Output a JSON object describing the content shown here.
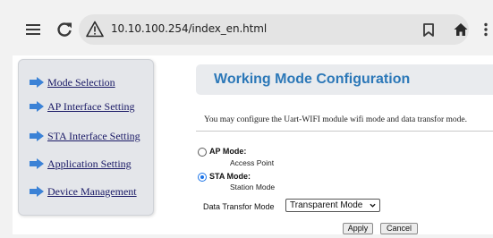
{
  "browser": {
    "url": "10.10.100.254/index_en.html",
    "icons": [
      "menu-icon",
      "reload-icon",
      "warning-icon",
      "bookmark-icon",
      "home-icon",
      "more-icon"
    ]
  },
  "sidebar": {
    "items": [
      {
        "label": "Mode Selection"
      },
      {
        "label": "AP Interface Setting"
      },
      {
        "label": "STA Interface Setting"
      },
      {
        "label": "Application Setting"
      },
      {
        "label": "Device Management"
      }
    ]
  },
  "main": {
    "title": "Working Mode Configuration",
    "description": "You may configure the Uart-WIFI module wifi mode and data transfor mode.",
    "modes": [
      {
        "label": "AP Mode:",
        "sub": "Access Point",
        "checked": false
      },
      {
        "label": "STA Mode:",
        "sub": "Station Mode",
        "checked": true
      }
    ],
    "transfer_label": "Data Transfor Mode",
    "transfer_value": "Transparent Mode",
    "apply_label": "Apply",
    "cancel_label": "Cancel"
  },
  "colors": {
    "title": "#2c78b8",
    "nav_link": "#1a1a66",
    "nav_arrow": "#3b82d6",
    "radio_checked": "#1a73e8"
  }
}
